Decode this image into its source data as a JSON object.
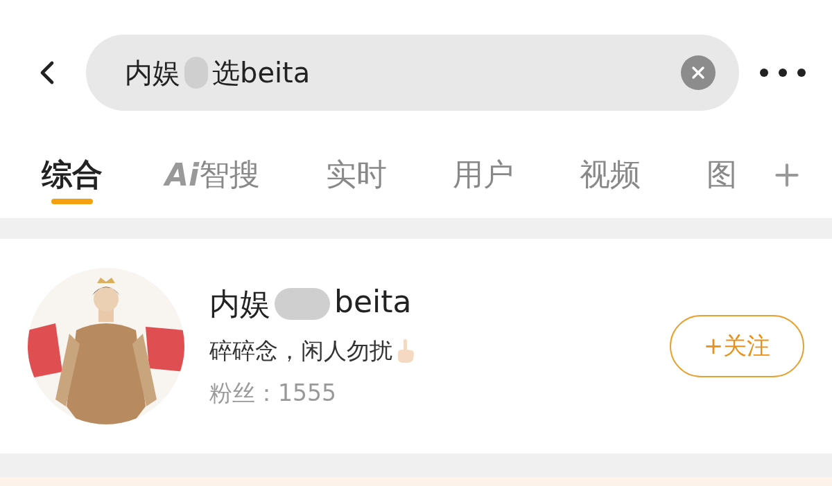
{
  "search": {
    "value_parts": [
      "内娱",
      "选beita"
    ]
  },
  "tabs": [
    {
      "label": "综合",
      "kind": "text",
      "selected": true
    },
    {
      "label": "Ai",
      "label2": "智搜",
      "kind": "logo",
      "selected": false
    },
    {
      "label": "实时",
      "kind": "text",
      "selected": false
    },
    {
      "label": "用户",
      "kind": "text",
      "selected": false
    },
    {
      "label": "视频",
      "kind": "text",
      "selected": false
    },
    {
      "label": "图",
      "kind": "text",
      "selected": false
    }
  ],
  "user": {
    "name_parts": [
      "内娱",
      "beita"
    ],
    "bio": "碎碎念，闲人勿扰",
    "fans": "粉丝：1555",
    "follow": "+关注"
  }
}
